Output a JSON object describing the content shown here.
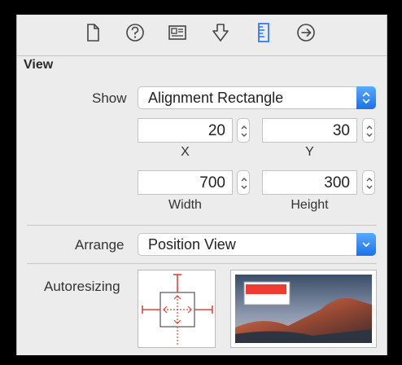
{
  "toolbar": {
    "icons": [
      "file-icon",
      "help-icon",
      "identity-icon",
      "attributes-icon",
      "size-ruler-icon",
      "connections-icon"
    ],
    "selected": "size-ruler-icon",
    "accent": "#2f7bf6"
  },
  "section": {
    "title": "View"
  },
  "show": {
    "label": "Show",
    "value": "Alignment Rectangle"
  },
  "position": {
    "x_value": "20",
    "x_label": "X",
    "y_value": "30",
    "y_label": "Y"
  },
  "size": {
    "width_value": "700",
    "width_label": "Width",
    "height_value": "300",
    "height_label": "Height"
  },
  "arrange": {
    "label": "Arrange",
    "value": "Position View"
  },
  "autoresizing": {
    "label": "Autoresizing",
    "strut_color": "#e8413a"
  }
}
